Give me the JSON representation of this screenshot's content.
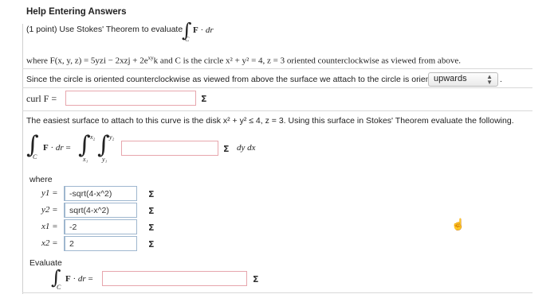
{
  "header": {
    "title": "Help Entering Answers"
  },
  "problem": {
    "intro": "(1 point) Use Stokes' Theorem to evaluate",
    "where_line": "where F(x, y, z) = 5yzi − 2xzj + 2e",
    "exp": "xy",
    "where_line_rest": "k and C is the circle x² + y² = 4, z = 3 oriented counterclockwise as viewed from above.",
    "orient_text": "Since the circle is oriented counterclockwise as viewed from above the surface we attach to the circle is oriented",
    "orient_select": "upwards",
    "curl_label": "curl F =",
    "surface_text": "The easiest surface to attach to this curve is the disk x² + y² ≤ 4, z = 3. Using this surface in Stokes' Theorem evaluate the following.",
    "dydx": "dy dx",
    "where_label": "where",
    "limits": [
      {
        "label": "y1 =",
        "value": "-sqrt(4-x^2)"
      },
      {
        "label": "y2 =",
        "value": "sqrt(4-x^2)"
      },
      {
        "label": "x1 =",
        "value": "-2"
      },
      {
        "label": "x2 =",
        "value": "2"
      }
    ],
    "evaluate_label": "Evaluate",
    "sigma": "Σ"
  }
}
